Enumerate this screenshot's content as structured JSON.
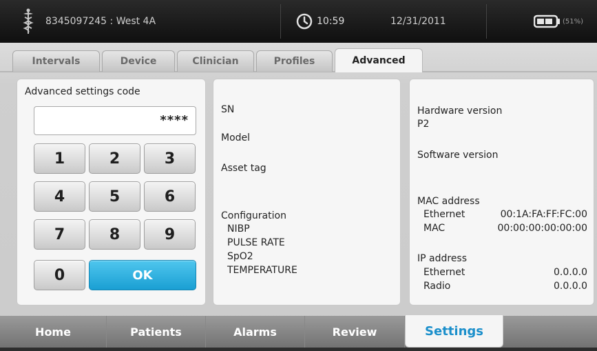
{
  "header": {
    "patient": "8345097245 : West 4A",
    "time": "10:59",
    "date": "12/31/2011",
    "battery_percent": "(51%)",
    "icons": [
      "caduceus-icon",
      "clock-icon",
      "battery-icon"
    ]
  },
  "top_tabs": [
    {
      "label": "Intervals",
      "active": false
    },
    {
      "label": "Device",
      "active": false
    },
    {
      "label": "Clinician",
      "active": false
    },
    {
      "label": "Profiles",
      "active": false
    },
    {
      "label": "Advanced",
      "active": true
    }
  ],
  "keypad": {
    "code_label": "Advanced settings code",
    "code_value": "****",
    "keys": [
      "1",
      "2",
      "3",
      "4",
      "5",
      "6",
      "7",
      "8",
      "9",
      "0"
    ],
    "ok_label": "OK"
  },
  "device_info": {
    "sn": "SN",
    "model": "Model",
    "asset_tag": "Asset tag",
    "configuration": "Configuration",
    "config_items": [
      "NIBP",
      "PULSE RATE",
      "SpO2",
      "TEMPERATURE"
    ]
  },
  "versions": {
    "hardware_label": "Hardware version",
    "hardware_value": "P2",
    "software_label": "Software version",
    "mac_label": "MAC address",
    "mac_rows": [
      {
        "name": "Ethernet",
        "value": "00:1A:FA:FF:FC:00"
      },
      {
        "name": "MAC",
        "value": "00:00:00:00:00:00"
      }
    ],
    "ip_label": "IP address",
    "ip_rows": [
      {
        "name": "Ethernet",
        "value": "0.0.0.0"
      },
      {
        "name": "Radio",
        "value": "0.0.0.0"
      }
    ]
  },
  "bottom_nav": [
    {
      "label": "Home",
      "active": false
    },
    {
      "label": "Patients",
      "active": false
    },
    {
      "label": "Alarms",
      "active": false
    },
    {
      "label": "Review",
      "active": false
    },
    {
      "label": "Settings",
      "active": true
    }
  ],
  "colors": {
    "accent": "#1a9fd3",
    "header_bg": "#1a1a1a",
    "active_nav_text": "#1b8fcb"
  }
}
